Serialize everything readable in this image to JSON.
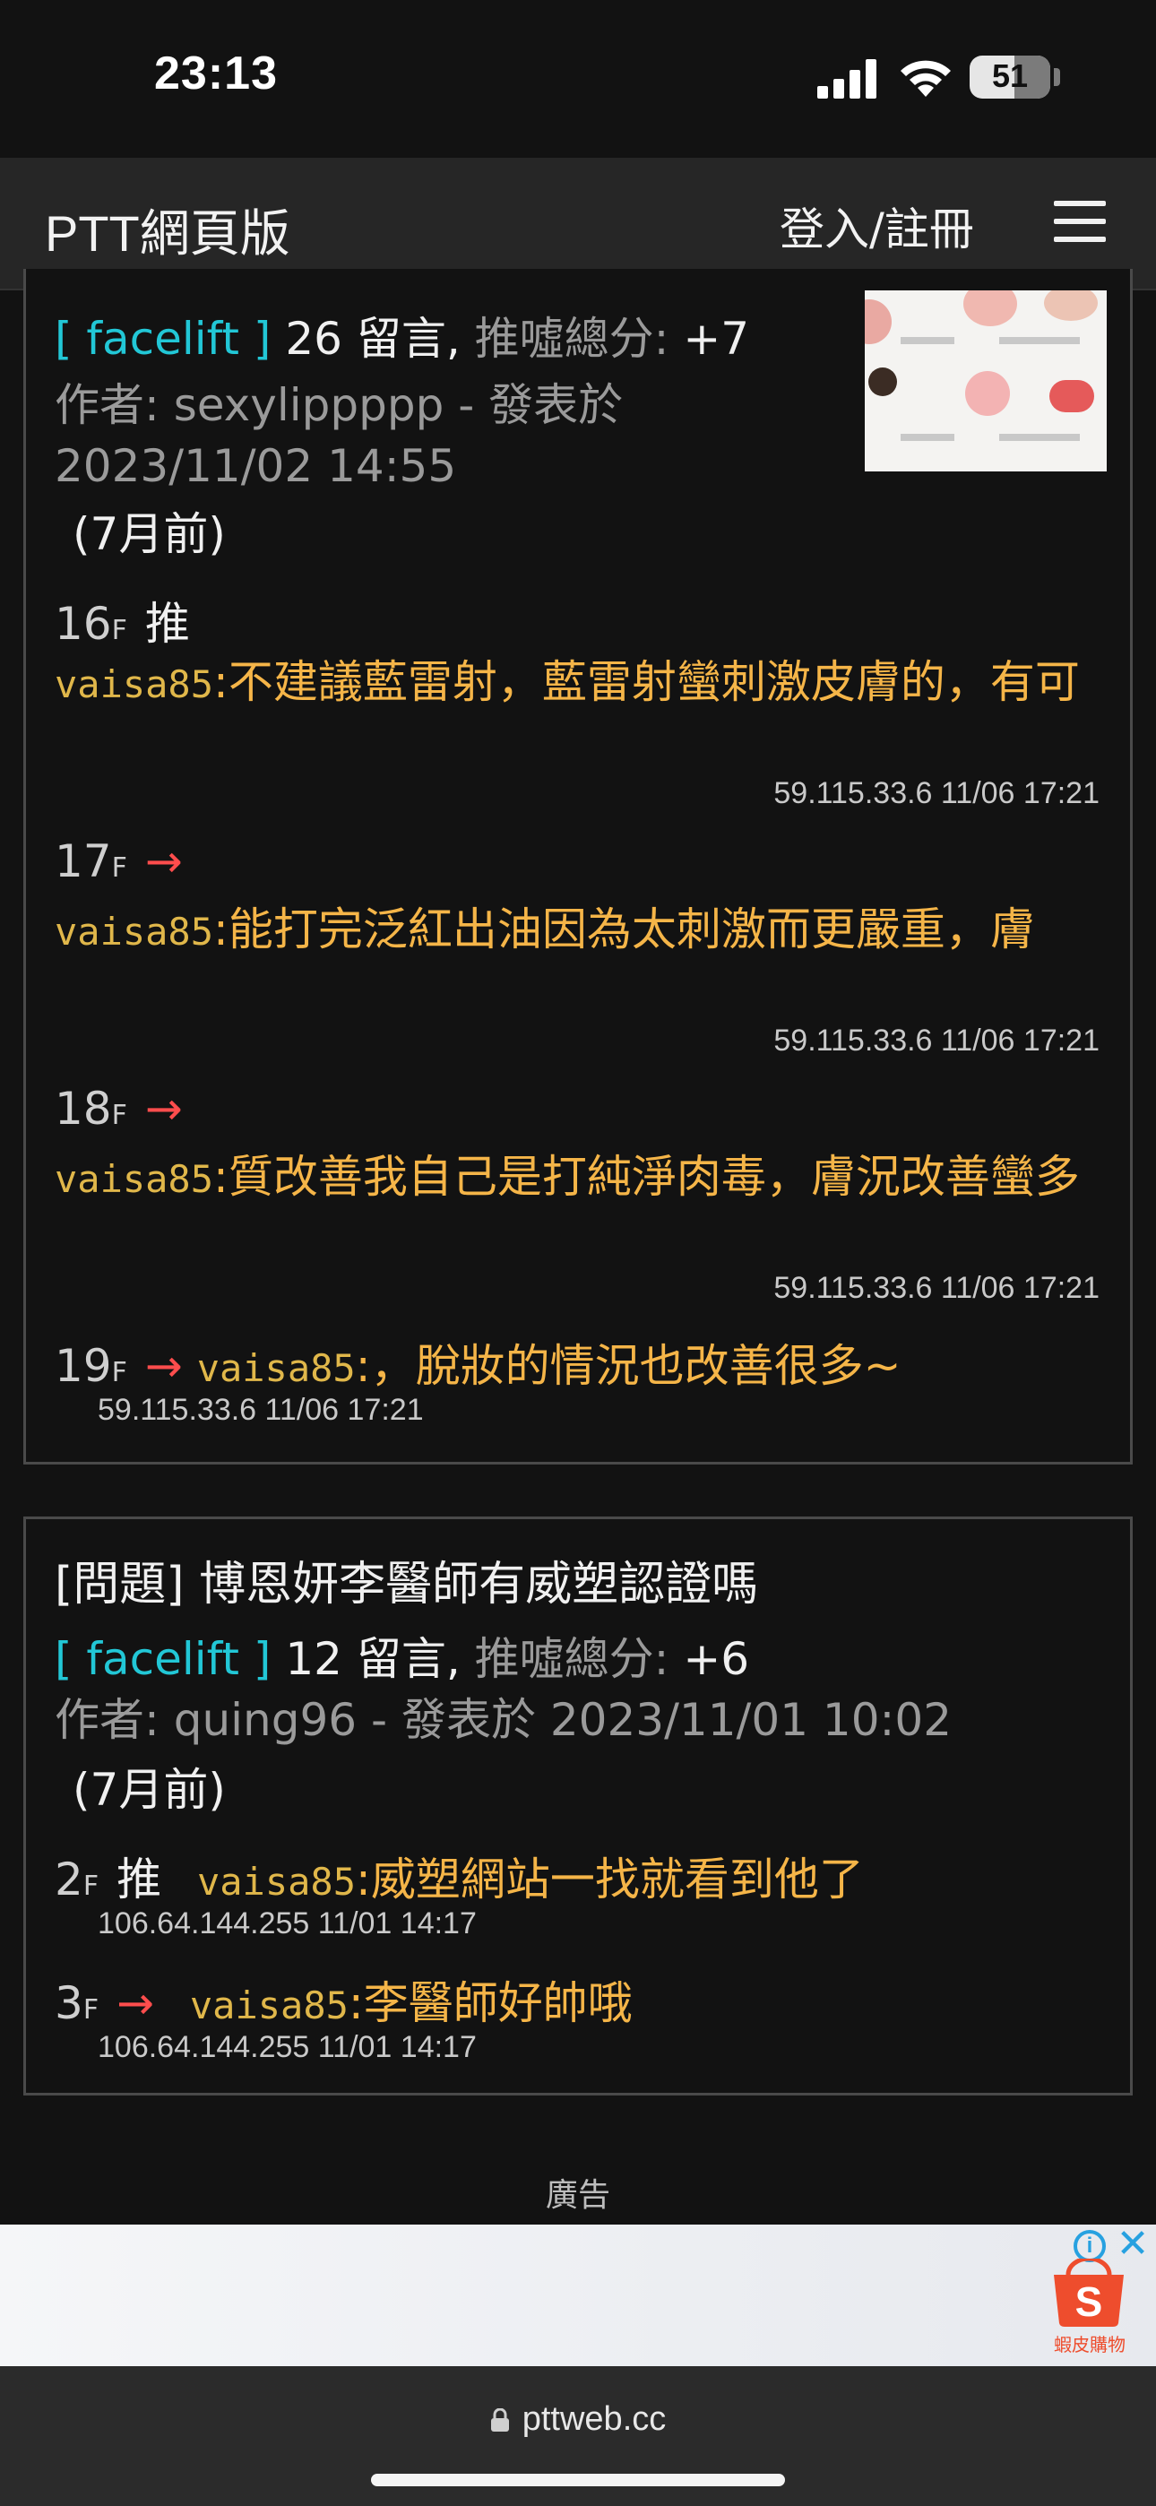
{
  "status_bar": {
    "time": "23:13",
    "battery": "51"
  },
  "nav": {
    "brand": "PTT網頁版",
    "login": "登入/註冊"
  },
  "post1": {
    "board": "[ facelift ]",
    "count": "26 留言,",
    "score_label": "推噓總分:",
    "score": "+7",
    "author_line1": "作者: sexylippppp - 發表於",
    "author_line2": "2023/11/02 14:55",
    "ago": "(7月前)",
    "comments": [
      {
        "floor": "16",
        "f": "F",
        "tag": "推",
        "user": "vaisa85",
        "colon": ":",
        "text": "不建議藍雷射，藍雷射蠻刺激皮膚的，有可",
        "ip": "59.115.33.6 11/06 17:21"
      },
      {
        "floor": "17",
        "f": "F",
        "tag": "→",
        "user": "vaisa85",
        "colon": ":",
        "text": "能打完泛紅出油因為太刺激而更嚴重，膚",
        "ip": "59.115.33.6 11/06 17:21"
      },
      {
        "floor": "18",
        "f": "F",
        "tag": "→",
        "user": "vaisa85",
        "colon": ":",
        "text": "質改善我自己是打純淨肉毒，膚況改善蠻多",
        "ip": "59.115.33.6 11/06 17:21"
      },
      {
        "floor": "19",
        "f": "F",
        "tag": "→",
        "user": "vaisa85",
        "colon": ":",
        "text": "，脫妝的情況也改善很多~",
        "ip": "59.115.33.6 11/06 17:21"
      }
    ]
  },
  "post2": {
    "title": "[問題] 博恩妍李醫師有威塑認證嗎",
    "board": "[ facelift ]",
    "count": "12 留言,",
    "score_label": "推噓總分:",
    "score": "+6",
    "author": "作者: quing96 - 發表於 2023/11/01 10:02",
    "ago": "(7月前)",
    "comments": [
      {
        "floor": "2",
        "f": "F",
        "tag": "推",
        "user": "vaisa85",
        "colon": ":",
        "text": "威塑網站一找就看到他了",
        "ip": "106.64.144.255 11/01 14:17"
      },
      {
        "floor": "3",
        "f": "F",
        "tag": "→",
        "user": "vaisa85",
        "colon": ":",
        "text": "李醫師好帥哦",
        "ip": "106.64.144.255 11/01 14:17"
      }
    ]
  },
  "ad": {
    "label": "廣告",
    "brand_text": "蝦皮購物",
    "info": "i",
    "close": "✕"
  },
  "browser": {
    "url": "pttweb.cc"
  },
  "colors": {
    "board": "#22c7d6",
    "comment": "#f5b548",
    "arrow": "#ff4d4d",
    "background": "#121212"
  },
  "icons": [
    "signal-icon",
    "wifi-icon",
    "battery-icon",
    "menu-icon",
    "lock-icon",
    "ad-info-icon",
    "ad-close-icon",
    "shopee-logo-icon"
  ]
}
